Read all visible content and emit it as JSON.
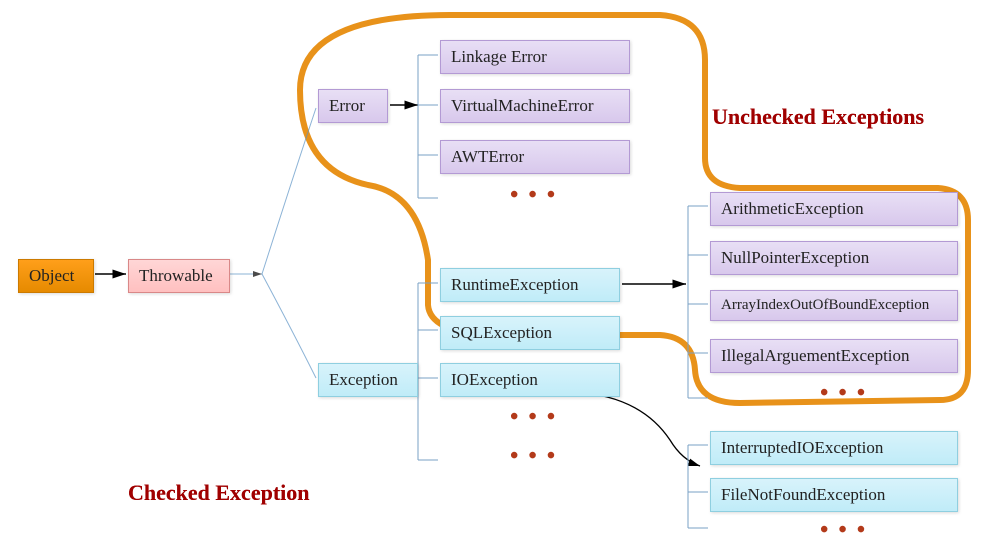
{
  "nodes": {
    "root": "Object",
    "throwable": "Throwable",
    "error": "Error",
    "exception": "Exception",
    "error_children": [
      "Linkage Error",
      "VirtualMachineError",
      "AWTError"
    ],
    "runtime": "RuntimeException",
    "sql": "SQLException",
    "io": "IOException",
    "runtime_children": [
      "ArithmeticException",
      "NullPointerException",
      "ArrayIndexOutOfBoundException",
      "IllegalArguementException"
    ],
    "io_children": [
      "InterruptedIOException",
      "FileNotFoundException"
    ]
  },
  "labels": {
    "unchecked": "Unchecked Exceptions",
    "checked": "Checked Exception"
  },
  "ellipsis": "• • •",
  "colors": {
    "orange": "#ff9f1a",
    "pink": "#ffc0c0",
    "purple": "#d8c8ec",
    "cyan": "#c0ecf8",
    "outline": "#e8921a",
    "label": "#a00000"
  }
}
